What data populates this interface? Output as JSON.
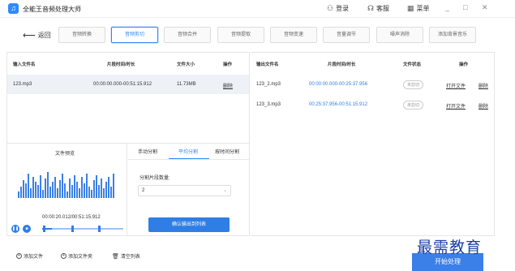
{
  "app": {
    "title": "全能王音频处理大师",
    "logo_glyph": "♫"
  },
  "titlebar": {
    "login": "登录",
    "service": "客服",
    "menu": "菜单",
    "minimize": "_",
    "restore": "□",
    "close": "✕"
  },
  "toolbar": {
    "back": "返回",
    "tabs": [
      "音频转换",
      "音频剪切",
      "音频合并",
      "音频提取",
      "音频变速",
      "音量调节",
      "噪声消除",
      "添加背景音乐"
    ],
    "active_tab": "音频剪切"
  },
  "left_table": {
    "headers": [
      "输入文件名",
      "片段时间/时长",
      "文件大小",
      "操作"
    ],
    "rows": [
      {
        "name": "123.mp3",
        "time": "00:00:00.000-00:51:15.912",
        "size": "11.73MB",
        "action": "删除"
      }
    ]
  },
  "right_table": {
    "headers": [
      "输出文件名",
      "片段时间/时长",
      "文件状态",
      "操作"
    ],
    "rows": [
      {
        "name": "123_2.mp3",
        "time": "00:00:00.000-00:25:37.956",
        "status": "未剪切",
        "open": "打开文件",
        "del": "删除"
      },
      {
        "name": "123_3.mp3",
        "time": "00:25:37.956-00:51:15.912",
        "status": "未剪切",
        "open": "打开文件",
        "del": "删除"
      }
    ]
  },
  "preview": {
    "title": "文件预览",
    "time": "00:00:20.012/00:51:15.912",
    "progress": 0.12
  },
  "split": {
    "tabs": [
      "手动分割",
      "平均分割",
      "按时间分割"
    ],
    "active": "平均分割",
    "seg_label": "分割片段数量:",
    "seg_value": "2",
    "confirm": "确认输出到列表"
  },
  "bottom": {
    "add_file": "添加文件",
    "add_folder": "添加文件夹",
    "clear": "清空列表",
    "start": "开始处理"
  },
  "watermark": "最需教育",
  "colors": {
    "accent": "#2f7ee6"
  }
}
